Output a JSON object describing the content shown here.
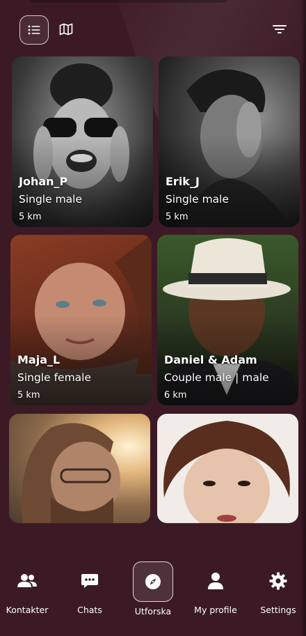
{
  "top_bar": {
    "list_view_icon": "list-icon",
    "map_view_icon": "map-icon",
    "filter_icon": "filter-icon"
  },
  "profiles": [
    {
      "name": "Johan_P",
      "type": "Single male",
      "distance": "5 km"
    },
    {
      "name": "Erik_J",
      "type": "Single male",
      "distance": "5 km"
    },
    {
      "name": "Maja_L",
      "type": "Single female",
      "distance": "5 km"
    },
    {
      "name": "Daniel & Adam",
      "type": "Couple male | male",
      "distance": "6 km"
    },
    {
      "name": "",
      "type": "",
      "distance": ""
    },
    {
      "name": "",
      "type": "",
      "distance": ""
    }
  ],
  "nav": {
    "items": [
      {
        "label": "Kontakter",
        "icon": "contacts-icon"
      },
      {
        "label": "Chats",
        "icon": "chat-icon"
      },
      {
        "label": "Utforska",
        "icon": "compass-icon",
        "active": true
      },
      {
        "label": "My profile",
        "icon": "profile-icon"
      },
      {
        "label": "Settings",
        "icon": "settings-icon"
      }
    ]
  },
  "colors": {
    "background": "#3c1a25",
    "text": "#ffffff"
  }
}
